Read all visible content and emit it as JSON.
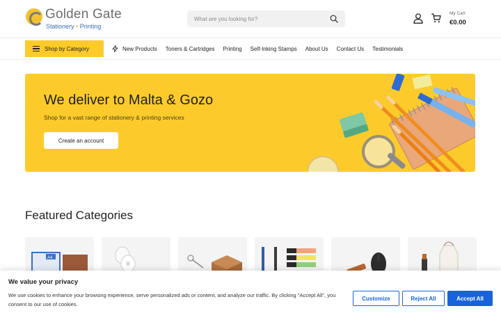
{
  "header": {
    "logo_name": "Golden Gate",
    "logo_tag_left": "Stationery",
    "logo_tag_dot": "•",
    "logo_tag_right": "Printing",
    "search_placeholder": "What are you looking for?",
    "cart_label": "My Cart",
    "cart_total": "€0.00"
  },
  "nav": {
    "shop_by_category": "Shop by Category",
    "links": [
      "New Products",
      "Toners & Cartridges",
      "Printing",
      "Self-Inking Stamps",
      "About Us",
      "Contact Us",
      "Testimonials"
    ]
  },
  "hero": {
    "title": "We deliver to Malta & Gozo",
    "subtitle": "Shop for a vast range of stationery & printing services",
    "button": "Create an account"
  },
  "featured": {
    "title": "Featured Categories",
    "card_tag": "A4"
  },
  "cookie": {
    "title": "We value your privacy",
    "text": "We use cookies to enhance your browsing experience, serve personalized ads or content, and analyze our traffic. By clicking \"Accept All\", you consent to our use of cookies.",
    "customize": "Customize",
    "reject": "Reject All",
    "accept": "Accept All"
  },
  "colors": {
    "brand_yellow": "#fccb2b",
    "accent_blue": "#1863dc",
    "logo_gray": "#6e6e6e",
    "logo_blue": "#3d6db5"
  }
}
